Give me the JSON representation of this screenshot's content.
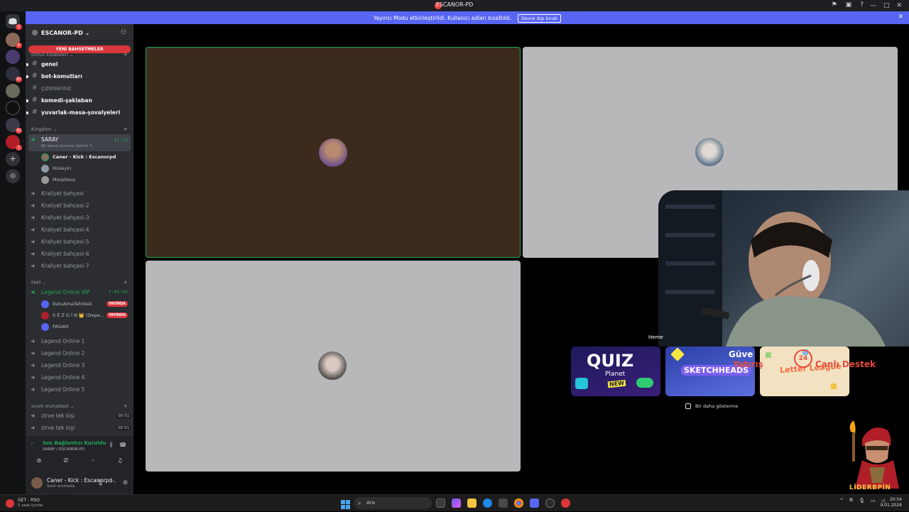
{
  "window": {
    "title": "ESCANOR-PD"
  },
  "banner": {
    "text": "Yayıncı Modu etkinleştirildi. Kullanıcı adları kısaltıldı.",
    "button": "Devre dışı bırak"
  },
  "guild": {
    "name": "ESCANOR-PD"
  },
  "mentions_pill": "YENİ BAHSETMELER",
  "categories": {
    "c1": "Örhuli kitabeleri",
    "c2": "Kingdom",
    "c3": "FAM",
    "c4": "sınırlı muhabbet"
  },
  "text_channels": [
    "genel",
    "bot-komutları",
    "çizimleriniz",
    "komedi-şaklaban",
    "yuvarlak-masa-şovalyeleri"
  ],
  "active_voice": {
    "name": "SARAY",
    "timer": "17:23",
    "status": "Bir kanal durumu belirle"
  },
  "saray_users": [
    "Caner - Kick : Escanorpd",
    "Hüseyin",
    "Morpheus"
  ],
  "kingdom_voice": [
    "Krallyet bahçesi",
    "Krallyet bahçesi-2",
    "Krallyet bahçesi-3",
    "Krallyet bahçesi-4",
    "Krallyet bahçesi-5",
    "Krallyet bahçesi-6",
    "Krallyet bahçesi-7"
  ],
  "fam_active": {
    "name": "Legend Online VİP",
    "timer": "7:05:03"
  },
  "fam_users": [
    {
      "name": "BatuAmaTehlikeli",
      "badge": "YAYINDA"
    },
    {
      "name": "S E Z G İ N 👑 (Depe...",
      "badge": "YAYINDA"
    },
    {
      "name": "PASAM",
      "badge": ""
    }
  ],
  "fam_voice": [
    "Legend Online 1",
    "Legend Online 2",
    "Legend Online 3",
    "Legend Online 4",
    "Legend Online 5"
  ],
  "sm_voice": [
    {
      "name": "zirve tek kişi",
      "a": "00",
      "b": "01"
    },
    {
      "name": "zirve tek kişi",
      "a": "00",
      "b": "01"
    }
  ],
  "voice_panel": {
    "status": "Ses Bağlantısı Kuruldu",
    "sub": "SARAY / ESCANOR-PD"
  },
  "me": {
    "name": "Caner - Kick : Escanorpd",
    "status": "Sesli aramada"
  },
  "overlay": {
    "hemen": "Heme",
    "text1": "Güve",
    "text2": "Yatırış",
    "text3": "Canlı Destek",
    "noshow": "Bir daha gösterme",
    "brand": "LİDERBPİN",
    "card1_title": "QUIZ",
    "card1_sub": "Planet",
    "card1_badge": "NEW",
    "card2_title": "SKETCHHEADS",
    "card3_title": "Letter League"
  },
  "taskbar": {
    "notif_title": "GET - RSO",
    "notif_sub": "5 saat içinde",
    "search": "Ara",
    "time": "20:54",
    "date": "9.01.2026"
  },
  "colors": {
    "accent": "#5865f2",
    "danger": "#da373c",
    "online": "#23a55a",
    "sidebar": "#2b2d31",
    "speaking_tile": "#3c2a1c",
    "tile_gray": "#b8b8ba"
  }
}
